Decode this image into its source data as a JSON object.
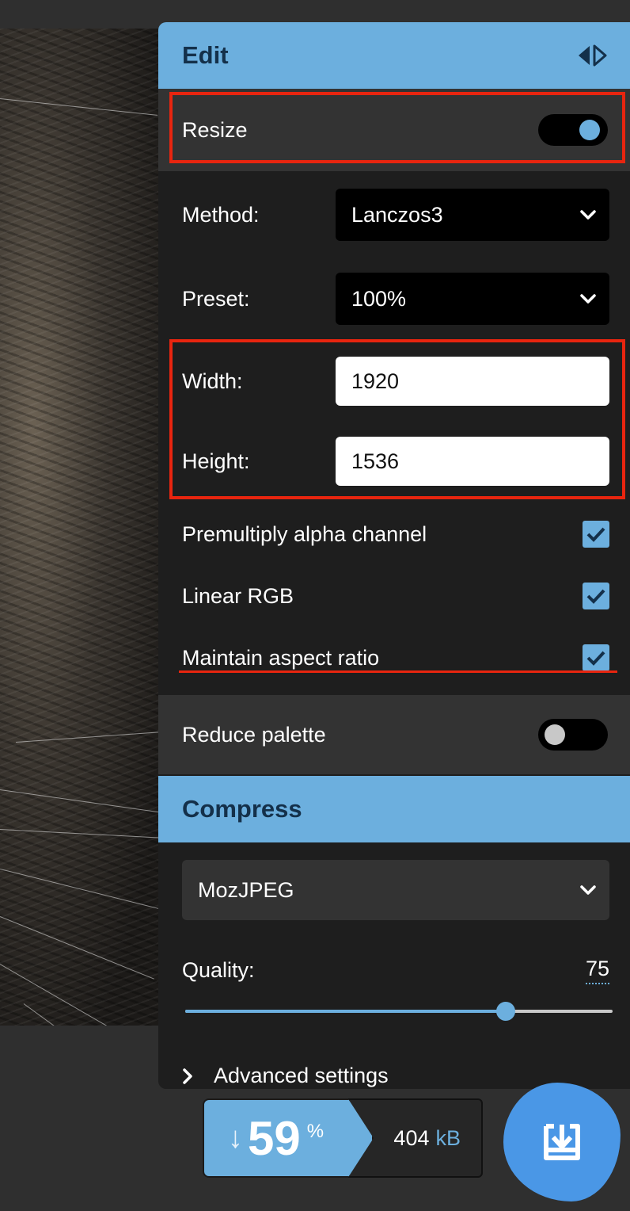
{
  "edit": {
    "title": "Edit",
    "resize": {
      "label": "Resize",
      "enabled": true
    },
    "method": {
      "label": "Method:",
      "value": "Lanczos3"
    },
    "preset": {
      "label": "Preset:",
      "value": "100%"
    },
    "width": {
      "label": "Width:",
      "value": "1920"
    },
    "height": {
      "label": "Height:",
      "value": "1536"
    },
    "premultiply": {
      "label": "Premultiply alpha channel",
      "checked": true
    },
    "linear_rgb": {
      "label": "Linear RGB",
      "checked": true
    },
    "aspect": {
      "label": "Maintain aspect ratio",
      "checked": true
    },
    "reduce_palette": {
      "label": "Reduce palette",
      "enabled": false
    }
  },
  "compress": {
    "title": "Compress",
    "codec": "MozJPEG",
    "quality_label": "Quality:",
    "quality_value": "75",
    "quality_fraction": 0.75,
    "advanced_label": "Advanced settings"
  },
  "result": {
    "arrow": "↓",
    "percent": "59",
    "percent_symbol": "%",
    "size": "404",
    "unit": "kB"
  },
  "colors": {
    "accent": "#6cafde",
    "highlight": "#e8250f",
    "download": "#4a97e6"
  }
}
